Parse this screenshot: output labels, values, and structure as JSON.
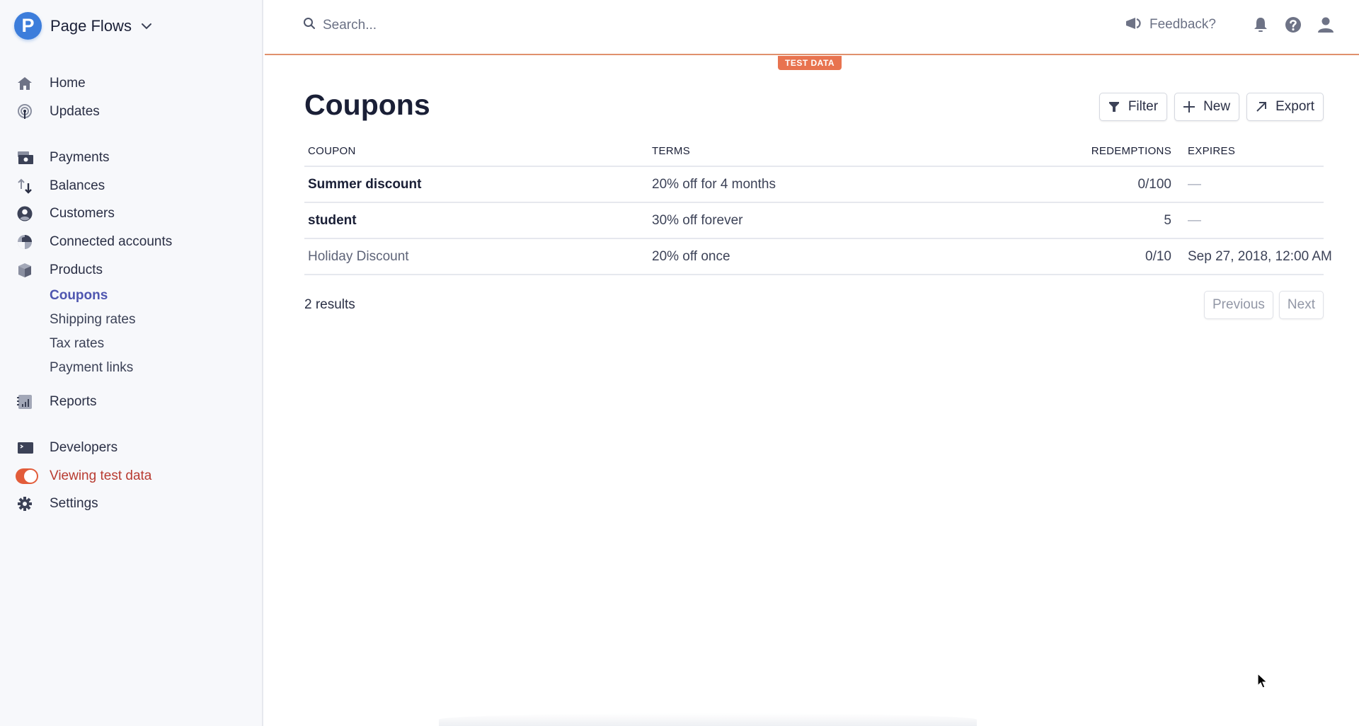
{
  "brand": {
    "initial": "P",
    "name": "Page Flows"
  },
  "sidebar": {
    "items": [
      {
        "label": "Home",
        "icon": "home-icon"
      },
      {
        "label": "Updates",
        "icon": "updates-icon"
      },
      {
        "label": "Payments",
        "icon": "payments-icon"
      },
      {
        "label": "Balances",
        "icon": "balances-icon"
      },
      {
        "label": "Customers",
        "icon": "customers-icon"
      },
      {
        "label": "Connected accounts",
        "icon": "connected-accounts-icon"
      },
      {
        "label": "Products",
        "icon": "products-icon"
      }
    ],
    "product_subitems": [
      {
        "label": "Coupons",
        "active": true
      },
      {
        "label": "Shipping rates",
        "active": false
      },
      {
        "label": "Tax rates",
        "active": false
      },
      {
        "label": "Payment links",
        "active": false
      }
    ],
    "reports": {
      "label": "Reports",
      "icon": "reports-icon"
    },
    "developers": {
      "label": "Developers",
      "icon": "terminal-icon"
    },
    "test_mode": {
      "label": "Viewing test data",
      "enabled": true
    },
    "settings": {
      "label": "Settings",
      "icon": "gear-icon"
    }
  },
  "header": {
    "search_placeholder": "Search...",
    "feedback_label": "Feedback?",
    "test_badge": "TEST DATA"
  },
  "main": {
    "title": "Coupons",
    "actions": {
      "filter": "Filter",
      "new": "New",
      "export": "Export"
    },
    "table": {
      "columns": [
        "COUPON",
        "TERMS",
        "REDEMPTIONS",
        "EXPIRES"
      ],
      "rows": [
        {
          "coupon": "Summer discount",
          "terms": "20% off for 4 months",
          "redemptions": "0/100",
          "expires": "—",
          "muted": false
        },
        {
          "coupon": "student",
          "terms": "30% off forever",
          "redemptions": "5",
          "expires": "—",
          "muted": false
        },
        {
          "coupon": "Holiday Discount",
          "terms": "20% off once",
          "redemptions": "0/10",
          "expires": "Sep 27, 2018, 12:00 AM",
          "muted": true
        }
      ]
    },
    "results_label": "2 results",
    "pagination": {
      "previous": "Previous",
      "next": "Next"
    }
  },
  "colors": {
    "brand_blue": "#3c7ddb",
    "active_nav": "#4f56b0",
    "test_mode_accent": "#e8734f",
    "test_mode_text": "#b83b31"
  }
}
